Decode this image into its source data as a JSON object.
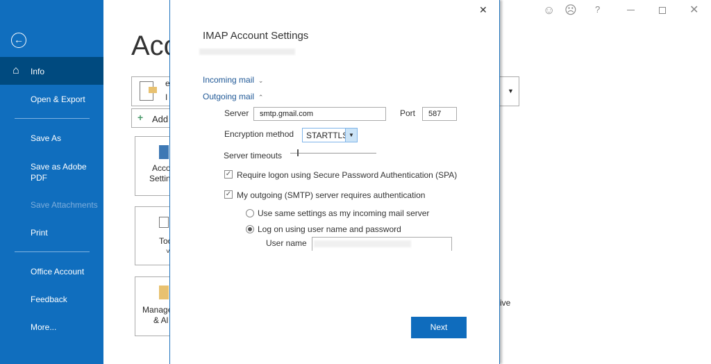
{
  "sidebar": {
    "items": [
      {
        "label": "Info"
      },
      {
        "label": "Open & Export"
      },
      {
        "label": "Save As"
      },
      {
        "label": "Save as Adobe PDF"
      },
      {
        "label": "Save Attachments"
      },
      {
        "label": "Print"
      },
      {
        "label": "Office Account"
      },
      {
        "label": "Feedback"
      },
      {
        "label": "More..."
      }
    ]
  },
  "background": {
    "title": "Acc",
    "account_line1": "e",
    "account_line2": "I",
    "add_label": "Add",
    "tile1_l1": "Acco",
    "tile1_l2": "Settin",
    "tile2_l1": "Too",
    "tile2_l2": "˅",
    "tile3_l1": "Manage",
    "tile3_l2": "& Al",
    "partial_text": "ive"
  },
  "dialog": {
    "title": "IMAP Account Settings",
    "incoming_label": "Incoming mail",
    "outgoing_label": "Outgoing mail",
    "server_label": "Server",
    "server_value": "smtp.gmail.com",
    "port_label": "Port",
    "port_value": "587",
    "encryption_label": "Encryption method",
    "encryption_value": "STARTTLS",
    "timeouts_label": "Server timeouts",
    "timeout_level": 0.05,
    "spa_label": "Require logon using Secure Password Authentication (SPA)",
    "smtp_auth_label": "My outgoing (SMTP) server requires authentication",
    "same_settings_label": "Use same settings as my incoming mail server",
    "logon_label": "Log on using user name and password",
    "username_label": "User name",
    "next_label": "Next"
  },
  "colors": {
    "accent": "#106ebe",
    "selected": "#004a7f"
  }
}
